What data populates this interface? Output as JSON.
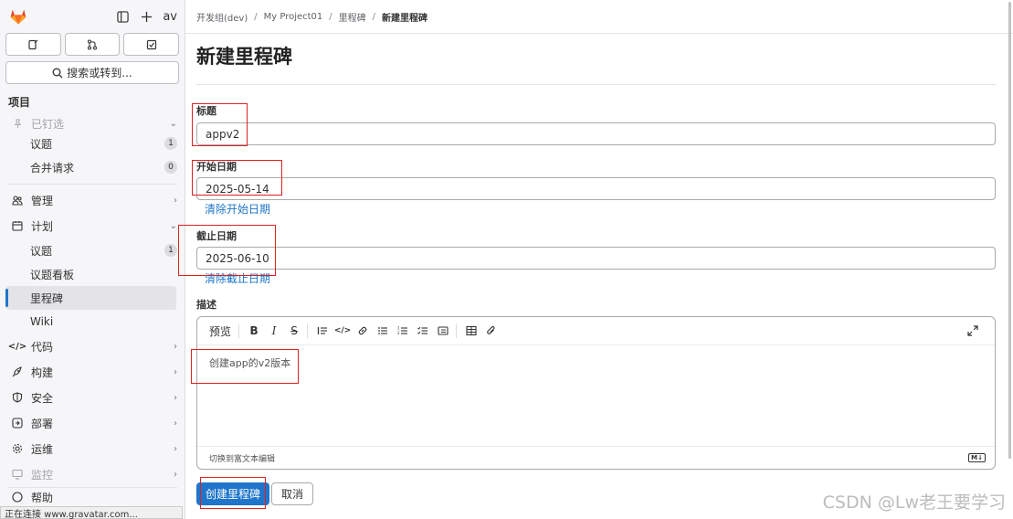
{
  "sidebar": {
    "avatar_text": "av",
    "search_label": "搜索或转到...",
    "section_title": "项目",
    "pinned_label": "已钉选",
    "pinned_items": [
      {
        "label": "议题",
        "count": "1"
      },
      {
        "label": "合并请求",
        "count": "0"
      }
    ],
    "manage_label": "管理",
    "plan_label": "计划",
    "plan_items": [
      {
        "label": "议题",
        "count": "1"
      },
      {
        "label": "议题看板"
      },
      {
        "label": "里程碑"
      },
      {
        "label": "Wiki"
      }
    ],
    "groups": [
      "代码",
      "构建",
      "安全",
      "部署",
      "运维",
      "监控"
    ],
    "help_label": "帮助"
  },
  "status_bar": "正在连接 www.gravatar.com...",
  "breadcrumb": [
    "开发组(dev)",
    "My Project01",
    "里程碑",
    "新建里程碑"
  ],
  "page": {
    "title": "新建里程碑",
    "title_label": "标题",
    "title_value": "appv2",
    "start_label": "开始日期",
    "start_value": "2025-05-14",
    "clear_start": "清除开始日期",
    "due_label": "截止日期",
    "due_value": "2025-06-10",
    "clear_due": "清除截止日期",
    "desc_label": "描述",
    "preview_tab": "预览",
    "desc_value": "创建app的v2版本",
    "rich_text_switch": "切换到富文本编辑",
    "markdown_badge": "M↓",
    "create_button": "创建里程碑",
    "cancel_button": "取消"
  },
  "colors": {
    "accent": "#1f75cb",
    "annotation": "#e02020"
  },
  "watermark": "CSDN @Lw老王要学习"
}
